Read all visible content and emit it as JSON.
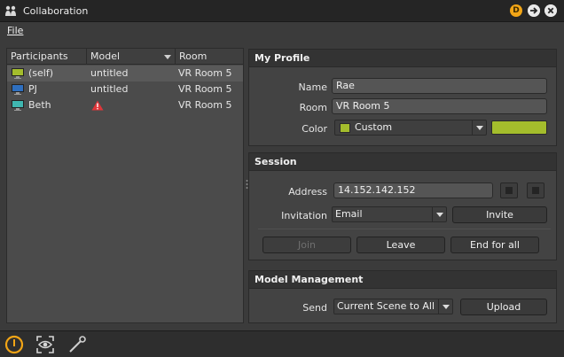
{
  "window": {
    "title": "Collaboration"
  },
  "menu": {
    "file": "File"
  },
  "colors": {
    "accent_orange": "#f2a516",
    "user_color": "#a4bd2c"
  },
  "participants": {
    "headers": [
      "Participants",
      "Model",
      "Room"
    ],
    "rows": [
      {
        "name": "(self)",
        "model": "untitled",
        "room": "VR Room 5",
        "icon": "monitor-icon",
        "icon_color": "#a4bd2c",
        "selected": true
      },
      {
        "name": "PJ",
        "model": "untitled",
        "room": "VR Room 5",
        "icon": "monitor-icon",
        "icon_color": "#2e6fbf",
        "selected": false
      },
      {
        "name": "Beth",
        "model": "",
        "model_icon": "warning-icon",
        "room": "VR Room 5",
        "icon": "monitor-icon",
        "icon_color": "#3fb6b0",
        "selected": false
      }
    ]
  },
  "my_profile": {
    "title": "My Profile",
    "name_label": "Name",
    "name_value": "Rae",
    "room_label": "Room",
    "room_value": "VR Room 5",
    "color_label": "Color",
    "color_value": "Custom"
  },
  "session": {
    "title": "Session",
    "address_label": "Address",
    "address_value": "14.152.142.152",
    "invitation_label": "Invitation",
    "invitation_value": "Email",
    "invite_label": "Invite",
    "join_label": "Join",
    "leave_label": "Leave",
    "end_label": "End for all"
  },
  "model_management": {
    "title": "Model Management",
    "send_label": "Send",
    "send_value": "Current Scene to All",
    "upload_label": "Upload"
  }
}
